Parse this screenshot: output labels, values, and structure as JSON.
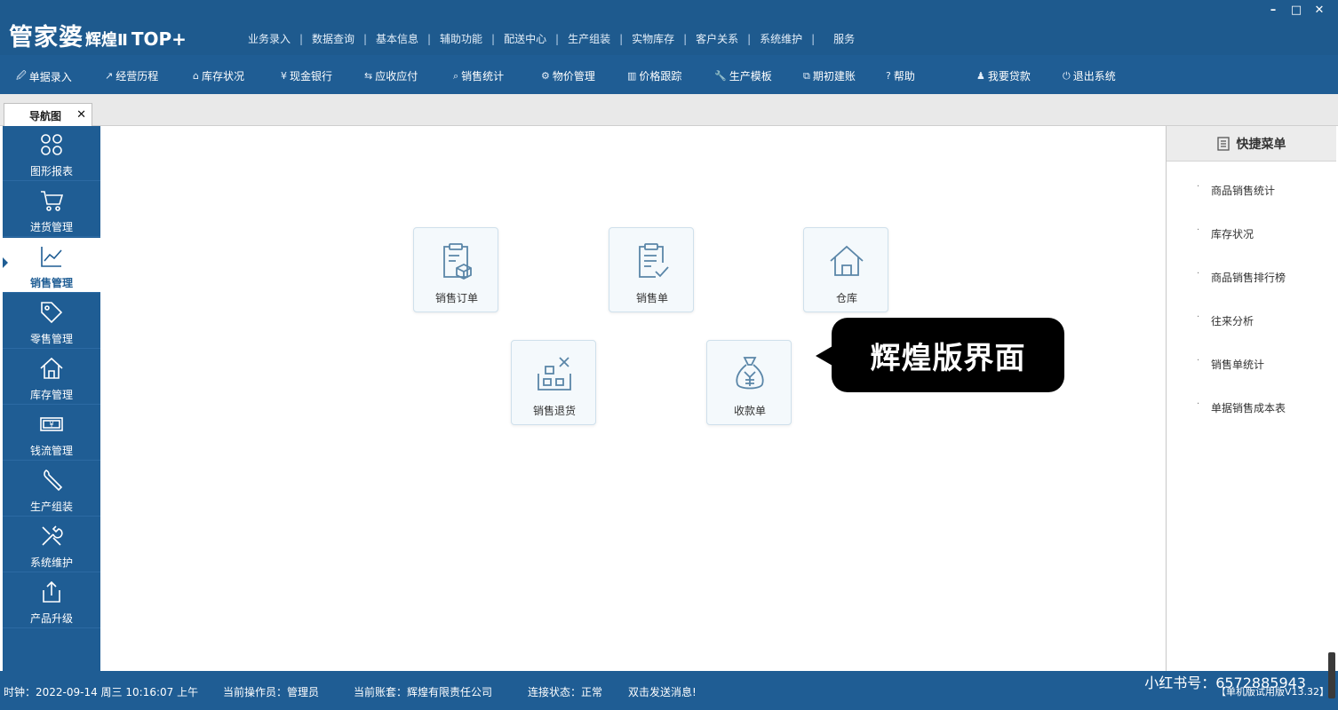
{
  "app": {
    "logo_main": "管家婆",
    "logo_sub": "辉煌Ⅱ",
    "logo_top": "TOP+"
  },
  "window_controls": [
    "–",
    "□",
    "✕"
  ],
  "topmenu": [
    "业务录入",
    "数据查询",
    "基本信息",
    "辅助功能",
    "配送中心",
    "生产组装",
    "实物库存",
    "客户关系",
    "系统维护",
    "服务"
  ],
  "toolbar": [
    {
      "label": "单据录入",
      "icon": "document-edit-icon"
    },
    {
      "label": "经营历程",
      "icon": "trend-icon"
    },
    {
      "label": "库存状况",
      "icon": "home-icon"
    },
    {
      "label": "现金银行",
      "icon": "yen-icon"
    },
    {
      "label": "应收应付",
      "icon": "exchange-icon"
    },
    {
      "label": "销售统计",
      "icon": "search-icon"
    },
    {
      "label": "物价管理",
      "icon": "gear-icon"
    },
    {
      "label": "价格跟踪",
      "icon": "bar-chart-icon"
    },
    {
      "label": "生产模板",
      "icon": "wrench-icon"
    },
    {
      "label": "期初建账",
      "icon": "external-link-icon"
    },
    {
      "label": "帮助",
      "icon": "help-icon"
    },
    {
      "label": "我要贷款",
      "icon": "money-bag-icon"
    },
    {
      "label": "退出系统",
      "icon": "power-icon"
    }
  ],
  "tab": {
    "label": "导航图",
    "close": "✕"
  },
  "leftnav": [
    {
      "label": "图形报表",
      "icon": "grid-icon"
    },
    {
      "label": "进货管理",
      "icon": "cart-icon"
    },
    {
      "label": "销售管理",
      "icon": "trend-chart-icon",
      "active": true
    },
    {
      "label": "零售管理",
      "icon": "tag-icon"
    },
    {
      "label": "库存管理",
      "icon": "home-icon"
    },
    {
      "label": "钱流管理",
      "icon": "banknote-icon"
    },
    {
      "label": "生产组装",
      "icon": "wrench-icon"
    },
    {
      "label": "系统维护",
      "icon": "tools-icon"
    },
    {
      "label": "产品升级",
      "icon": "upload-icon"
    }
  ],
  "tiles": [
    {
      "label": "销售订单",
      "icon": "order-box-icon"
    },
    {
      "label": "销售单",
      "icon": "checklist-icon"
    },
    {
      "label": "仓库",
      "icon": "warehouse-icon"
    },
    {
      "label": "销售退货",
      "icon": "return-goods-icon"
    },
    {
      "label": "收款单",
      "icon": "yen-bag-icon"
    }
  ],
  "callout": "辉煌版界面",
  "quickmenu": {
    "title": "快捷菜单",
    "items": [
      "商品销售统计",
      "库存状况",
      "商品销售排行榜",
      "往来分析",
      "销售单统计",
      "单据销售成本表"
    ]
  },
  "status": {
    "clock": "时钟：2022-09-14 周三 10:16:07 上午",
    "operator": "当前操作员：管理员",
    "account": "当前账套：辉煌有限责任公司",
    "connection": "连接状态：正常",
    "message": "双击发送消息!",
    "version": "【单机版试用版V13.32】",
    "watermark": "小红书号：6572885943"
  },
  "colors": {
    "primary": "#1f5d94",
    "titlebar": "#1e5a8e",
    "tile_bg": "#f4f9fc",
    "tile_icon": "#5a86a8",
    "callout": "#000000"
  }
}
